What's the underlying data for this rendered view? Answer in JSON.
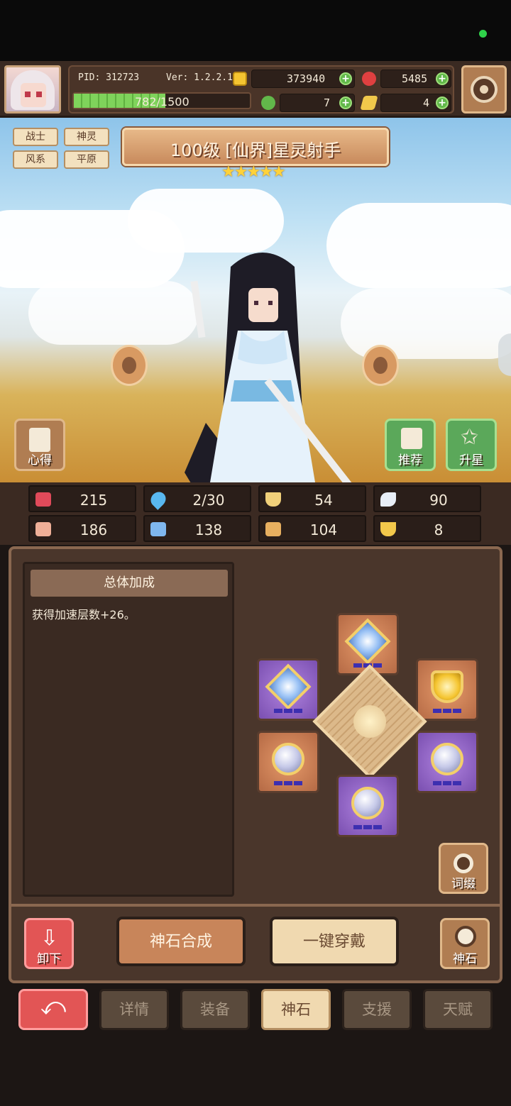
{
  "header": {
    "pid": "PID: 312723",
    "version": "Ver: 1.2.2.1",
    "gold": "373940",
    "gems": "5485",
    "clover": "7",
    "tickets": "4",
    "exp_text": "782/1500",
    "exp_progress": 0.52
  },
  "tags": [
    "战士",
    "神灵",
    "风系",
    "平原"
  ],
  "title": "100级 [仙界]星灵射手",
  "stars": 5,
  "scene_buttons": {
    "left_label": "心得",
    "recommend_label": "推荐",
    "upgrade_label": "升星"
  },
  "stats": [
    {
      "icon": "heart-icon",
      "value": "215",
      "color": "#e04a5a"
    },
    {
      "icon": "water-drop-icon",
      "value": "2/30",
      "color": "#59b8f0"
    },
    {
      "icon": "shield-icon",
      "value": "54",
      "color": "#f1d07a"
    },
    {
      "icon": "wing-icon",
      "value": "90",
      "color": "#e8eef6"
    },
    {
      "icon": "fist-icon",
      "value": "186",
      "color": "#f0b098"
    },
    {
      "icon": "book-icon",
      "value": "138",
      "color": "#7fb7ee"
    },
    {
      "icon": "boot-icon",
      "value": "104",
      "color": "#e8b060"
    },
    {
      "icon": "magnet-icon",
      "value": "8",
      "color": "#f2c84b"
    }
  ],
  "bonus": {
    "heading": "总体加成",
    "description": "获得加速层数+26。"
  },
  "affix_button": "词缀",
  "bottom_actions": {
    "unequip": "卸下",
    "synthesize": "神石合成",
    "equip_all": "一键穿戴",
    "stone": "神石"
  },
  "tabs": [
    "详情",
    "装备",
    "神石",
    "支援",
    "天赋"
  ],
  "active_tab": "神石",
  "colors": {
    "accent_orange": "#b07d52",
    "accent_green": "#62b84a",
    "back_red": "#e25555"
  }
}
